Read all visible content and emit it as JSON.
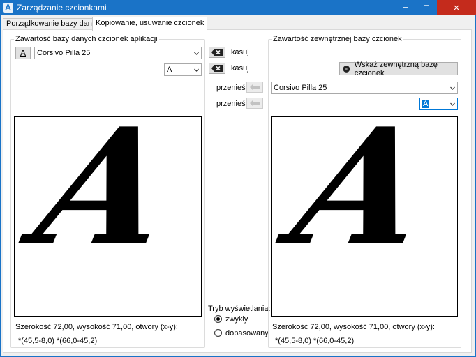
{
  "window": {
    "title": "Zarządzanie czcionkami",
    "minimize_glyph": "─",
    "maximize_glyph": "☐",
    "close_glyph": "✕"
  },
  "tabs": [
    {
      "label": "Porządkowanie bazy danych"
    },
    {
      "label": "Kopiowanie, usuwanie czcionek"
    }
  ],
  "left": {
    "group_title": "Zawartość bazy danych czcionek aplikacji",
    "char_button": "A",
    "font_select": "Corsivo Pilla 25",
    "char_select": "A",
    "glyph": "A",
    "size_info": "Szerokość 72,00, wysokość 71,00, otwory (x-y):",
    "holes": "*(45,5-8,0) *(66,0-45,2)"
  },
  "middle": {
    "delete_label_1": "kasuj",
    "delete_label_2": "kasuj",
    "move_label_1": "przenieś",
    "move_label_2": "przenieś",
    "mode_title": "Tryb wyświetlania:",
    "mode_normal": "zwykły",
    "mode_fitted": "dopasowany"
  },
  "right": {
    "group_title": "Zawartość zewnętrznej bazy czcionek",
    "browse_button": "Wskaż zewnętrzną bazę czcionek",
    "font_select": "Corsivo Pilla 25",
    "char_select": "A",
    "glyph": "A",
    "size_info": "Szerokość 72,00, wysokość 71,00, otwory (x-y):",
    "holes": "*(45,5-8,0) *(66,0-45,2)"
  },
  "colors": {
    "titlebar": "#1a73c7",
    "close_button": "#c42b1c",
    "selection": "#0078d7"
  }
}
